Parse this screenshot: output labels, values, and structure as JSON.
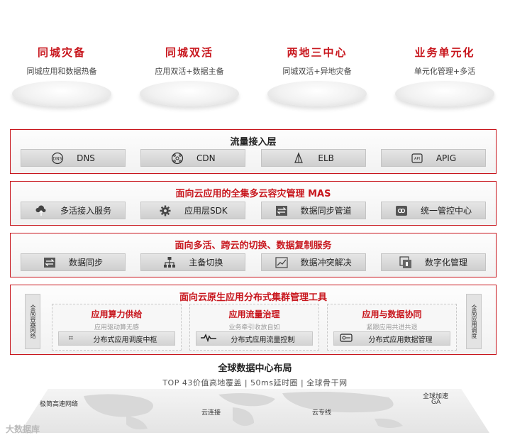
{
  "top_items": [
    {
      "title": "同城灾备",
      "subtitle": "同城应用和数据热备"
    },
    {
      "title": "同城双活",
      "subtitle": "应用双活+数据主备"
    },
    {
      "title": "两地三中心",
      "subtitle": "同城双活+异地灾备"
    },
    {
      "title": "业务单元化",
      "subtitle": "单元化管理+多活"
    }
  ],
  "layers": {
    "traffic": {
      "title": "流量接入层",
      "chips": [
        {
          "label": "DNS",
          "icon": "dns-icon"
        },
        {
          "label": "CDN",
          "icon": "cdn-icon"
        },
        {
          "label": "ELB",
          "icon": "elb-icon"
        },
        {
          "label": "APIG",
          "icon": "apig-icon"
        }
      ]
    },
    "mas": {
      "title": "面向云应用的全集多云容灾管理 MAS",
      "chips": [
        {
          "label": "多活接入服务",
          "icon": "cloud-upload-icon"
        },
        {
          "label": "应用层SDK",
          "icon": "gear-icon"
        },
        {
          "label": "数据同步管道",
          "icon": "sync-arrows-icon"
        },
        {
          "label": "统一管控中心",
          "icon": "control-center-icon"
        }
      ]
    },
    "switching": {
      "title": "面向多活、跨云的切换、数据复制服务",
      "chips": [
        {
          "label": "数据同步",
          "icon": "swap-icon"
        },
        {
          "label": "主备切换",
          "icon": "hierarchy-icon"
        },
        {
          "label": "数据冲突解决",
          "icon": "chart-line-icon"
        },
        {
          "label": "数字化管理",
          "icon": "digital-icon"
        }
      ]
    },
    "cluster": {
      "title": "面向云原生应用分布式集群管理工具",
      "left_label": "全局容器网络",
      "right_label": "全局应用调度",
      "caps": [
        {
          "title": "应用算力供给",
          "subtitle": "应用驱动算无感",
          "bar": "分布式应用调度中枢",
          "icon": "grid-icon"
        },
        {
          "title": "应用流量治理",
          "subtitle": "业务牵引收放自如",
          "bar": "分布式应用流量控制",
          "icon": "pulse-icon"
        },
        {
          "title": "应用与数据协同",
          "subtitle": "紧跟应用共进共退",
          "bar": "分布式应用数据管理",
          "icon": "data-icon"
        }
      ]
    }
  },
  "bottom": {
    "title": "全球数据中心布局",
    "subtitle": "TOP 43价值高地覆盖 | 50ms延时圈 | 全球骨干网",
    "map_labels": [
      "极简高速网络",
      "云连接",
      "云专线",
      "全球加速",
      "GA"
    ]
  },
  "watermark": "大数据库",
  "colors": {
    "accent": "#c8161d"
  }
}
